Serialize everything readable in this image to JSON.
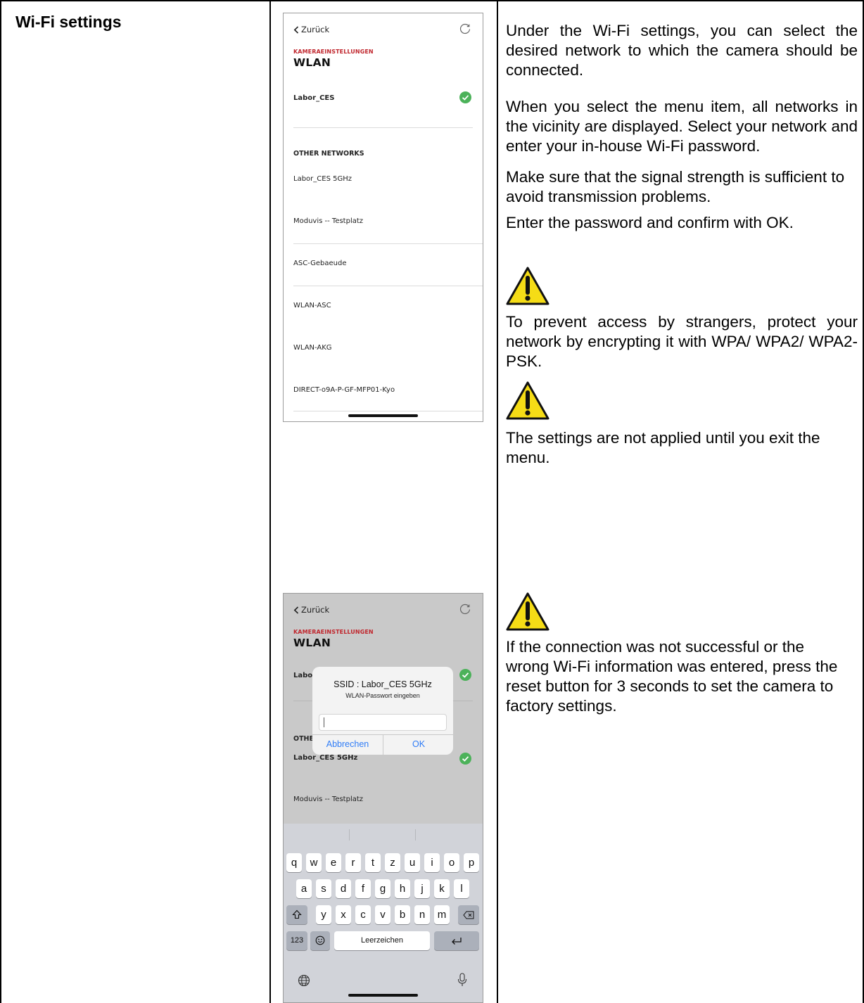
{
  "section": {
    "title": "Wi-Fi settings"
  },
  "phone1": {
    "back_label": "Zurück",
    "category": "KAMERAEINSTELLUNGEN",
    "title": "WLAN",
    "connected_network": "Labor_CES",
    "other_header": "OTHER NETWORKS",
    "networks": [
      "Labor_CES 5GHz",
      "Moduvis -- Testplatz",
      "ASC-Gebaeude",
      "WLAN-ASC",
      "WLAN-AKG",
      "DIRECT-o9A-P-GF-MFP01-Kyo"
    ]
  },
  "phone2": {
    "back_label": "Zurück",
    "category": "KAMERAEINSTELLUNGEN",
    "title": "WLAN",
    "row_partial": "Labo",
    "other_partial": "OTHE",
    "selected_network": "Labor_CES 5GHz",
    "network_below": "Moduvis -- Testplatz",
    "dialog": {
      "title": "SSID : Labor_CES 5GHz",
      "subtitle": "WLAN-Passwort eingeben",
      "cancel": "Abbrechen",
      "ok": "OK"
    },
    "keyboard": {
      "row1": [
        "q",
        "w",
        "e",
        "r",
        "t",
        "z",
        "u",
        "i",
        "o",
        "p"
      ],
      "row2": [
        "a",
        "s",
        "d",
        "f",
        "g",
        "h",
        "j",
        "k",
        "l"
      ],
      "row3": [
        "y",
        "x",
        "c",
        "v",
        "b",
        "n",
        "m"
      ],
      "numbers_key": "123",
      "space_label": "Leerzeichen"
    }
  },
  "text": {
    "p1": "Under the Wi-Fi settings, you can select the desired network to which the camera should be connected.",
    "p2": "When you select the menu item, all networks in the vicinity are displayed. Select your network and enter your in-house Wi-Fi password.",
    "p3": "Make sure that the signal strength is sufficient to avoid transmission problems.",
    "p4": "Enter the password and confirm with OK.",
    "warn1": "To prevent access by strangers, protect your network by encrypting it with WPA/ WPA2/ WPA2-PSK.",
    "warn2": "The settings are not applied until you exit the menu.",
    "warn3": "If the connection was not successful or the wrong Wi-Fi information was entered, press the reset button for 3 seconds to set the camera to factory settings."
  },
  "colors": {
    "accent_red": "#c0262d",
    "ios_blue": "#2f7cf6",
    "check_green": "#4cb25a",
    "warning_yellow": "#f5dc16"
  }
}
